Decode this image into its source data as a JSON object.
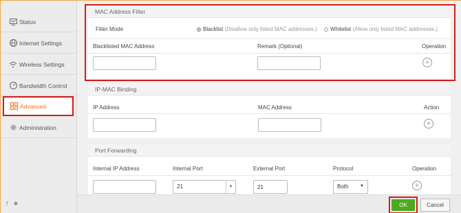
{
  "sidebar": {
    "items": [
      {
        "label": "Status",
        "icon": "monitor-icon"
      },
      {
        "label": "Internet Settings",
        "icon": "globe-icon"
      },
      {
        "label": "Wireless Settings",
        "icon": "wifi-icon"
      },
      {
        "label": "Bandwidth Control",
        "icon": "gauge-icon"
      },
      {
        "label": "Advanced",
        "icon": "grid-icon"
      },
      {
        "label": "Administration",
        "icon": "gear-icon"
      }
    ],
    "social": "f ✱"
  },
  "mac_filter": {
    "title": "MAC Address Filter",
    "mode_label": "Filter Mode",
    "blacklist_label": "Blacklist",
    "blacklist_desc": "(Disallow only listed MAC addresses.)",
    "whitelist_label": "Whitelist",
    "whitelist_desc": "(Allow only listed MAC addresses.)",
    "col_mac": "Blacklisted MAC Address",
    "col_remark": "Remark (Optional)",
    "col_operation": "Operation",
    "mac_value": "",
    "remark_value": ""
  },
  "ip_mac": {
    "title": "IP-MAC Binding",
    "col_ip": "IP Address",
    "col_mac": "MAC Address",
    "col_action": "Action",
    "ip_value": "",
    "mac_value": ""
  },
  "port_fwd": {
    "title": "Port Forwarding",
    "col_ip": "Internal IP Address",
    "col_internal_port": "Internal Port",
    "col_external_port": "External Port",
    "col_protocol": "Protocol",
    "col_operation": "Operation",
    "ip_value": "",
    "internal_port_value": "21",
    "external_port_value": "21",
    "protocol_value": "Both"
  },
  "footer": {
    "ok_label": "OK",
    "cancel_label": "Cancel"
  },
  "colors": {
    "accent": "#ff6a13",
    "ok": "#4caa1e",
    "highlight": "#d01c1c"
  }
}
